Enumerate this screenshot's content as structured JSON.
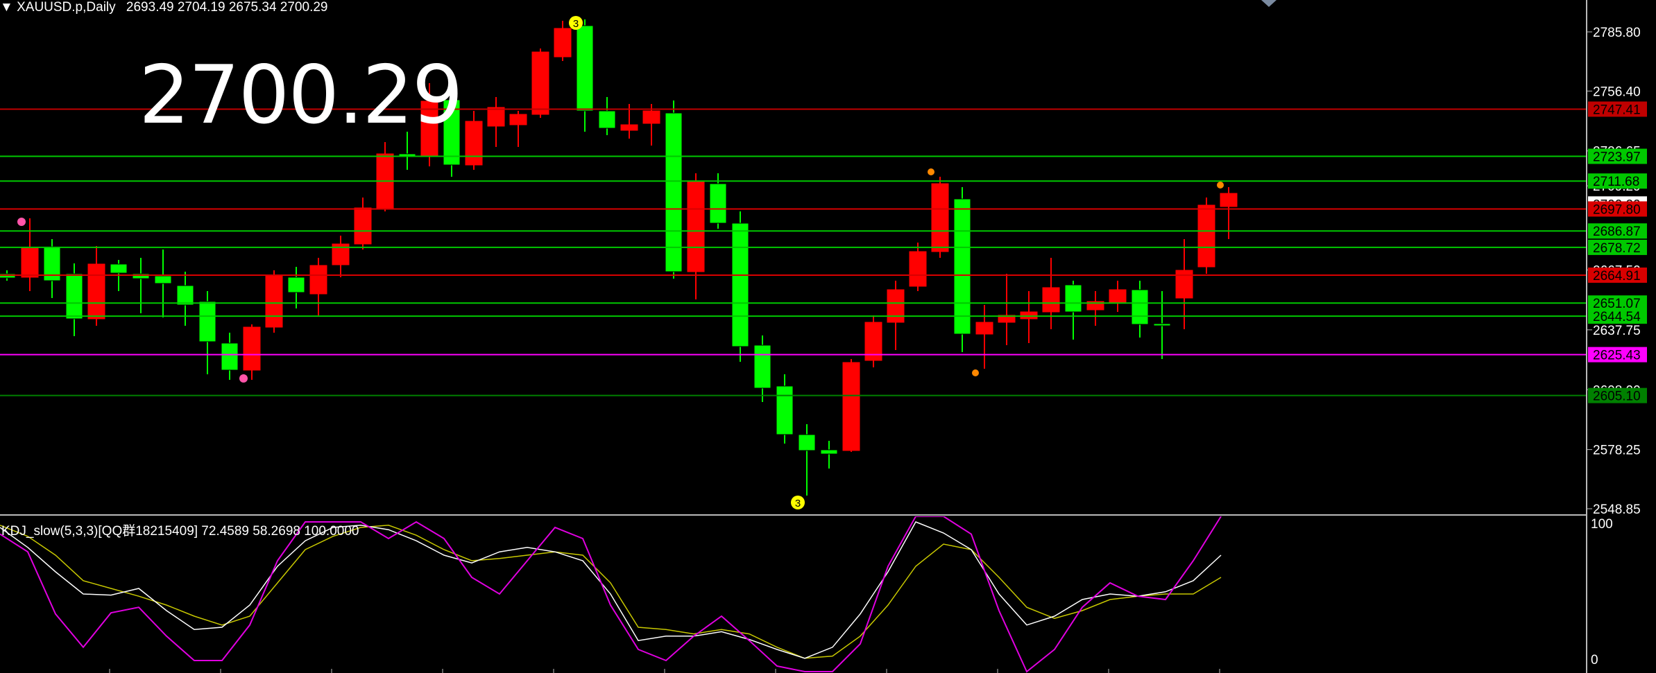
{
  "header": {
    "symbol": "XAUUSD.p,Daily",
    "ohlc": "2693.49 2704.19 2675.34 2700.29",
    "big_price": "2700.29"
  },
  "price_axis": {
    "ticks": [
      "2785.80",
      "2756.40",
      "2726.65",
      "2709.29",
      "2667.50",
      "2637.75",
      "2608.00",
      "2578.25",
      "2548.85"
    ]
  },
  "levels": [
    {
      "value": "2747.41",
      "color": "#c00000",
      "type": "line-red"
    },
    {
      "value": "2723.97",
      "color": "#00c800",
      "type": "line-green"
    },
    {
      "value": "2711.68",
      "color": "#00c800",
      "type": "line-green"
    },
    {
      "value": "2697.80",
      "color": "#d80000",
      "type": "line-red"
    },
    {
      "value": "2686.87",
      "color": "#00c800",
      "type": "line-green"
    },
    {
      "value": "2678.72",
      "color": "#00c800",
      "type": "line-green"
    },
    {
      "value": "2664.91",
      "color": "#d80000",
      "type": "line-red"
    },
    {
      "value": "2651.07",
      "color": "#00c800",
      "type": "line-green"
    },
    {
      "value": "2644.54",
      "color": "#00c800",
      "type": "line-green"
    },
    {
      "value": "2625.43",
      "color": "#ff00ff",
      "type": "line-magenta"
    },
    {
      "value": "2605.10",
      "color": "#008000",
      "type": "line-darkgreen"
    }
  ],
  "current_price": "2700.29",
  "markers": [
    {
      "label": "3",
      "color": "#ffff00",
      "kind": "top"
    },
    {
      "label": "3",
      "color": "#ffff00",
      "kind": "bottom"
    }
  ],
  "oscillator": {
    "title": "KDJ_slow(5,3,3)[QQ群18215409] 72.4589 58.2698 100.0000",
    "ticks": [
      "100",
      "0"
    ]
  },
  "colors": {
    "bull": "#00ff00",
    "bear": "#ff0000",
    "k_line": "#ffffff",
    "d_line": "#c8c800",
    "j_line": "#e000e0"
  }
}
